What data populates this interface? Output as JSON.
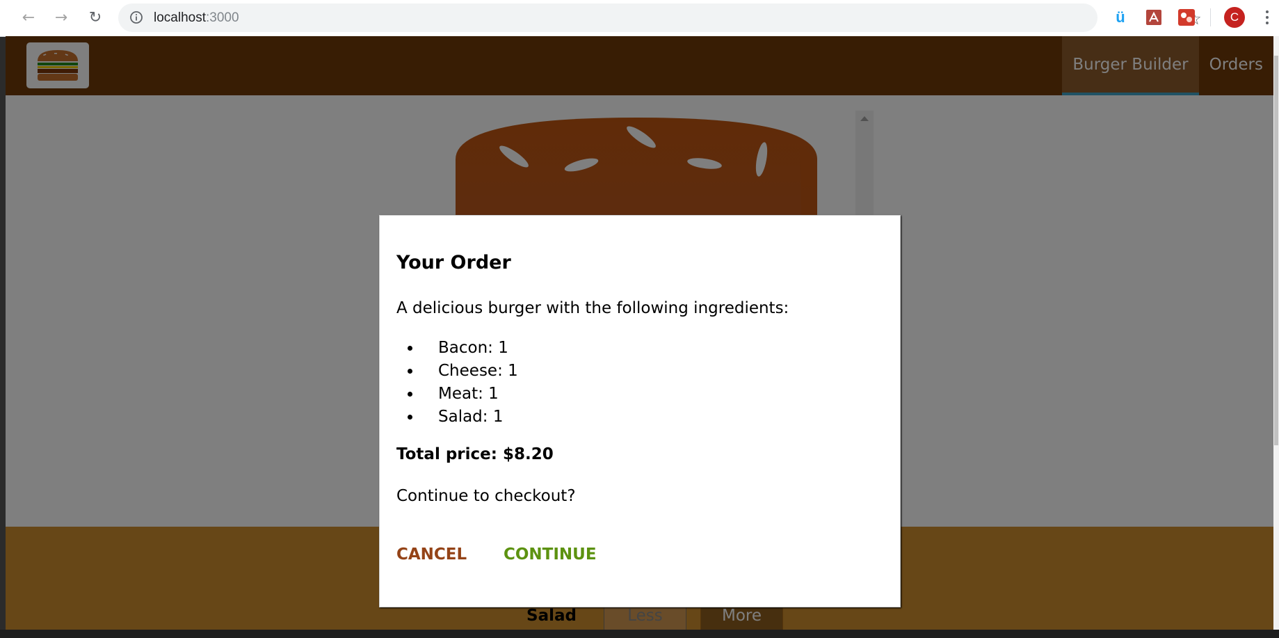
{
  "browser": {
    "url_host": "localhost",
    "url_port": ":3000",
    "profile_initial": "C",
    "icons": [
      "back-arrow-icon",
      "forward-arrow-icon",
      "reload-icon",
      "info-icon",
      "star-icon",
      "extension-icon",
      "pdf-icon",
      "puzzle-extension-icon",
      "menu-icon"
    ]
  },
  "toolbar": {
    "nav": [
      {
        "label": "Burger Builder",
        "active": true
      },
      {
        "label": "Orders",
        "active": false
      }
    ],
    "colors": {
      "toolbar": "#703b09",
      "active_item": "#8f5c2c",
      "active_border": "#40a4c8"
    }
  },
  "build_controls": {
    "row": {
      "label": "Salad",
      "less_label": "Less",
      "more_label": "More"
    }
  },
  "modal": {
    "title": "Your Order",
    "description": "A delicious burger with the following ingredients:",
    "ingredients": [
      "Bacon: 1",
      "Cheese: 1",
      "Meat: 1",
      "Salad: 1"
    ],
    "total_price": "Total price: $8.20",
    "question": "Continue to checkout?",
    "cancel_label": "CANCEL",
    "continue_label": "CONTINUE",
    "colors": {
      "cancel": "#944317",
      "continue": "#5c9210"
    }
  }
}
